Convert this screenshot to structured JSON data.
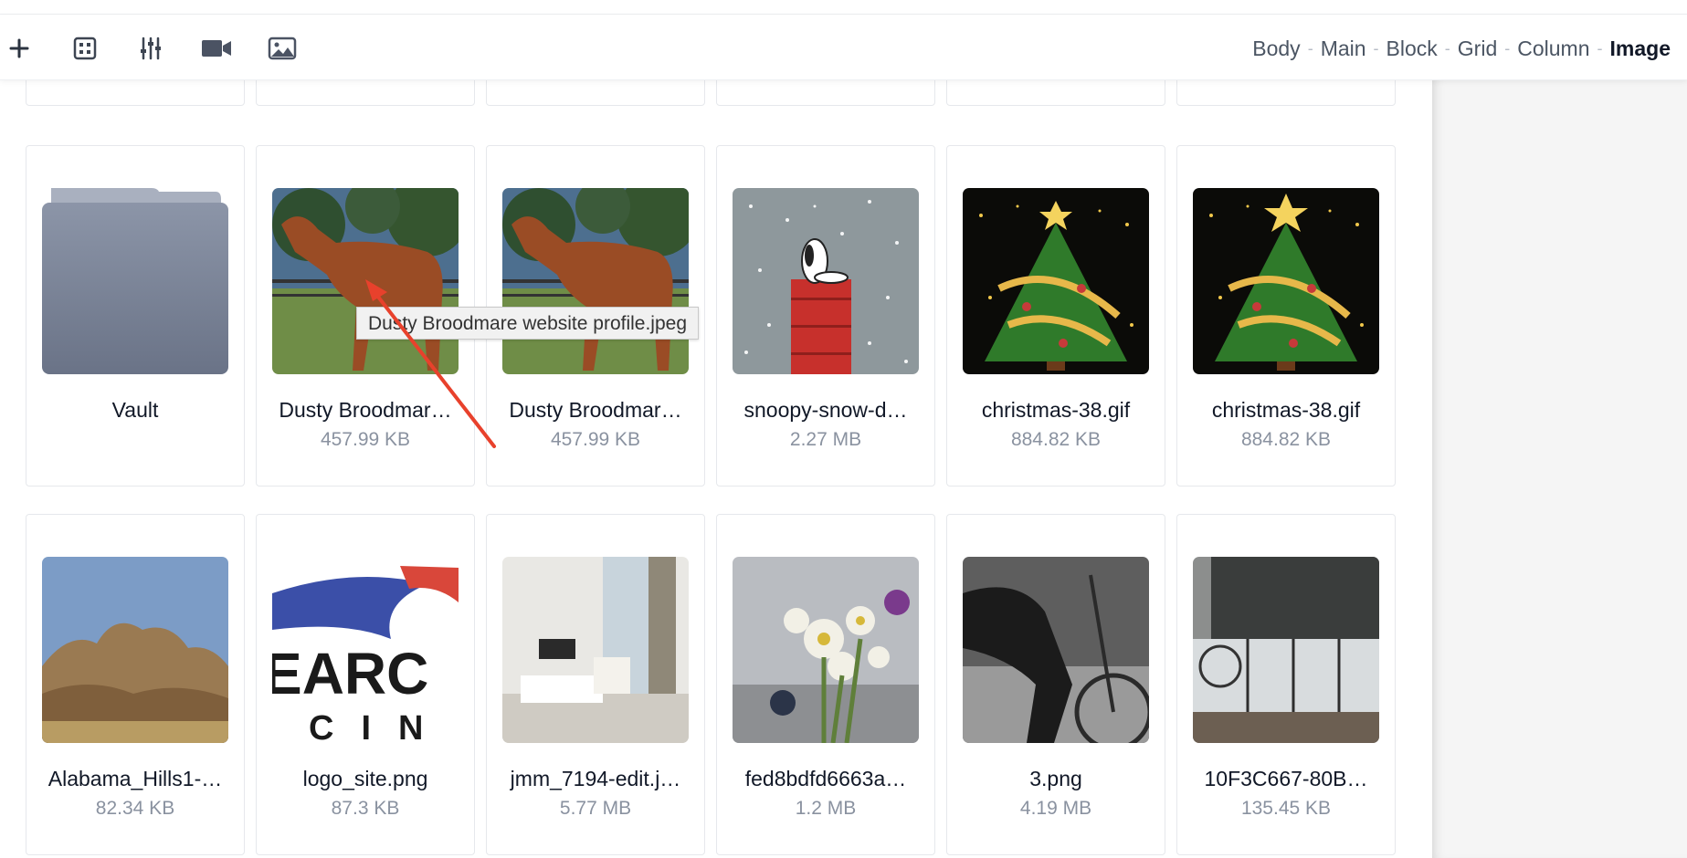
{
  "toolbar": {
    "icons": [
      "plus-icon",
      "grid-icon",
      "sliders-icon",
      "video-icon",
      "image-icon"
    ],
    "breadcrumb": [
      "Body",
      "Main",
      "Block",
      "Grid",
      "Column",
      "Image"
    ],
    "separator": "-"
  },
  "tooltip": "Dusty Broodmare website profile.jpeg",
  "row1": [
    {
      "name": "Vault",
      "size": "",
      "type": "folder"
    },
    {
      "name": "Dusty Broodmare website profile.jpeg",
      "display": "Dusty Broodmar…",
      "size": "457.99 KB",
      "type": "image"
    },
    {
      "name": "Dusty Broodmare website profile.jpeg",
      "display": "Dusty Broodmar…",
      "size": "457.99 KB",
      "type": "image"
    },
    {
      "name": "snoopy-snow-d…",
      "display": "snoopy-snow-d…",
      "size": "2.27 MB",
      "type": "image"
    },
    {
      "name": "christmas-38.gif",
      "display": "christmas-38.gif",
      "size": "884.82 KB",
      "type": "image"
    },
    {
      "name": "christmas-38.gif",
      "display": "christmas-38.gif",
      "size": "884.82 KB",
      "type": "image"
    }
  ],
  "row2": [
    {
      "display": "Alabama_Hills1-…",
      "size": "82.34 KB"
    },
    {
      "display": "logo_site.png",
      "size": "87.3 KB"
    },
    {
      "display": "jmm_7194-edit.j…",
      "size": "5.77 MB"
    },
    {
      "display": "fed8bdfd6663a…",
      "size": "1.2 MB"
    },
    {
      "display": "3.png",
      "size": "4.19 MB"
    },
    {
      "display": "10F3C667-80B…",
      "size": "135.45 KB"
    }
  ],
  "colors": {
    "accent_arrow": "#e8412c",
    "folder": "#7a8499",
    "tree_green": "#2f7a2a"
  }
}
